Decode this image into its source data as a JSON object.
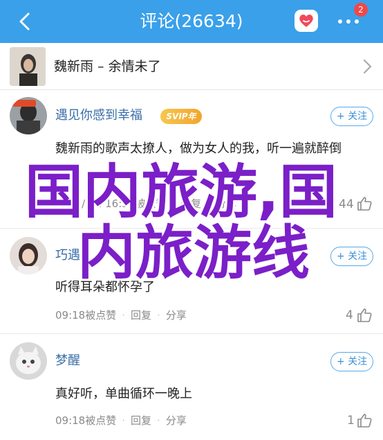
{
  "header": {
    "title": "评论(26634)",
    "badge_count": "2",
    "color": "#3aa0ea"
  },
  "song": {
    "title": "魏新雨 – 余情未了"
  },
  "comments": [
    {
      "username": "遇见你感到幸福",
      "vip_label": "SVIP年",
      "follow_label": "+ 关注",
      "text": "魏新雨的歌声太撩人，做为女人的我，听一遍就醉倒",
      "time": "2016/2/2 16:33",
      "like_label": "被点赞",
      "reply_label": "回复",
      "share_label": "分享",
      "likes": "44"
    },
    {
      "username": "巧遇",
      "follow_label": "+ 关注",
      "text": "听得耳朵都怀孕了",
      "time": "09:18",
      "like_label": "被点赞",
      "reply_label": "回复",
      "share_label": "分享",
      "likes": "4"
    },
    {
      "username": "梦醒",
      "follow_label": "+ 关注",
      "text": "真好听，单曲循环一晚上",
      "time": "09:18",
      "like_label": "被点赞",
      "reply_label": "回复",
      "share_label": "分享",
      "likes": "1"
    }
  ],
  "overlay": {
    "line1": "国内旅游,国",
    "line2": "内旅游线",
    "color": "#7b1fc8"
  },
  "icons": [
    "back-arrow-icon",
    "heart-icon",
    "more-dots-icon",
    "chevron-right-icon",
    "thumb-up-icon"
  ]
}
